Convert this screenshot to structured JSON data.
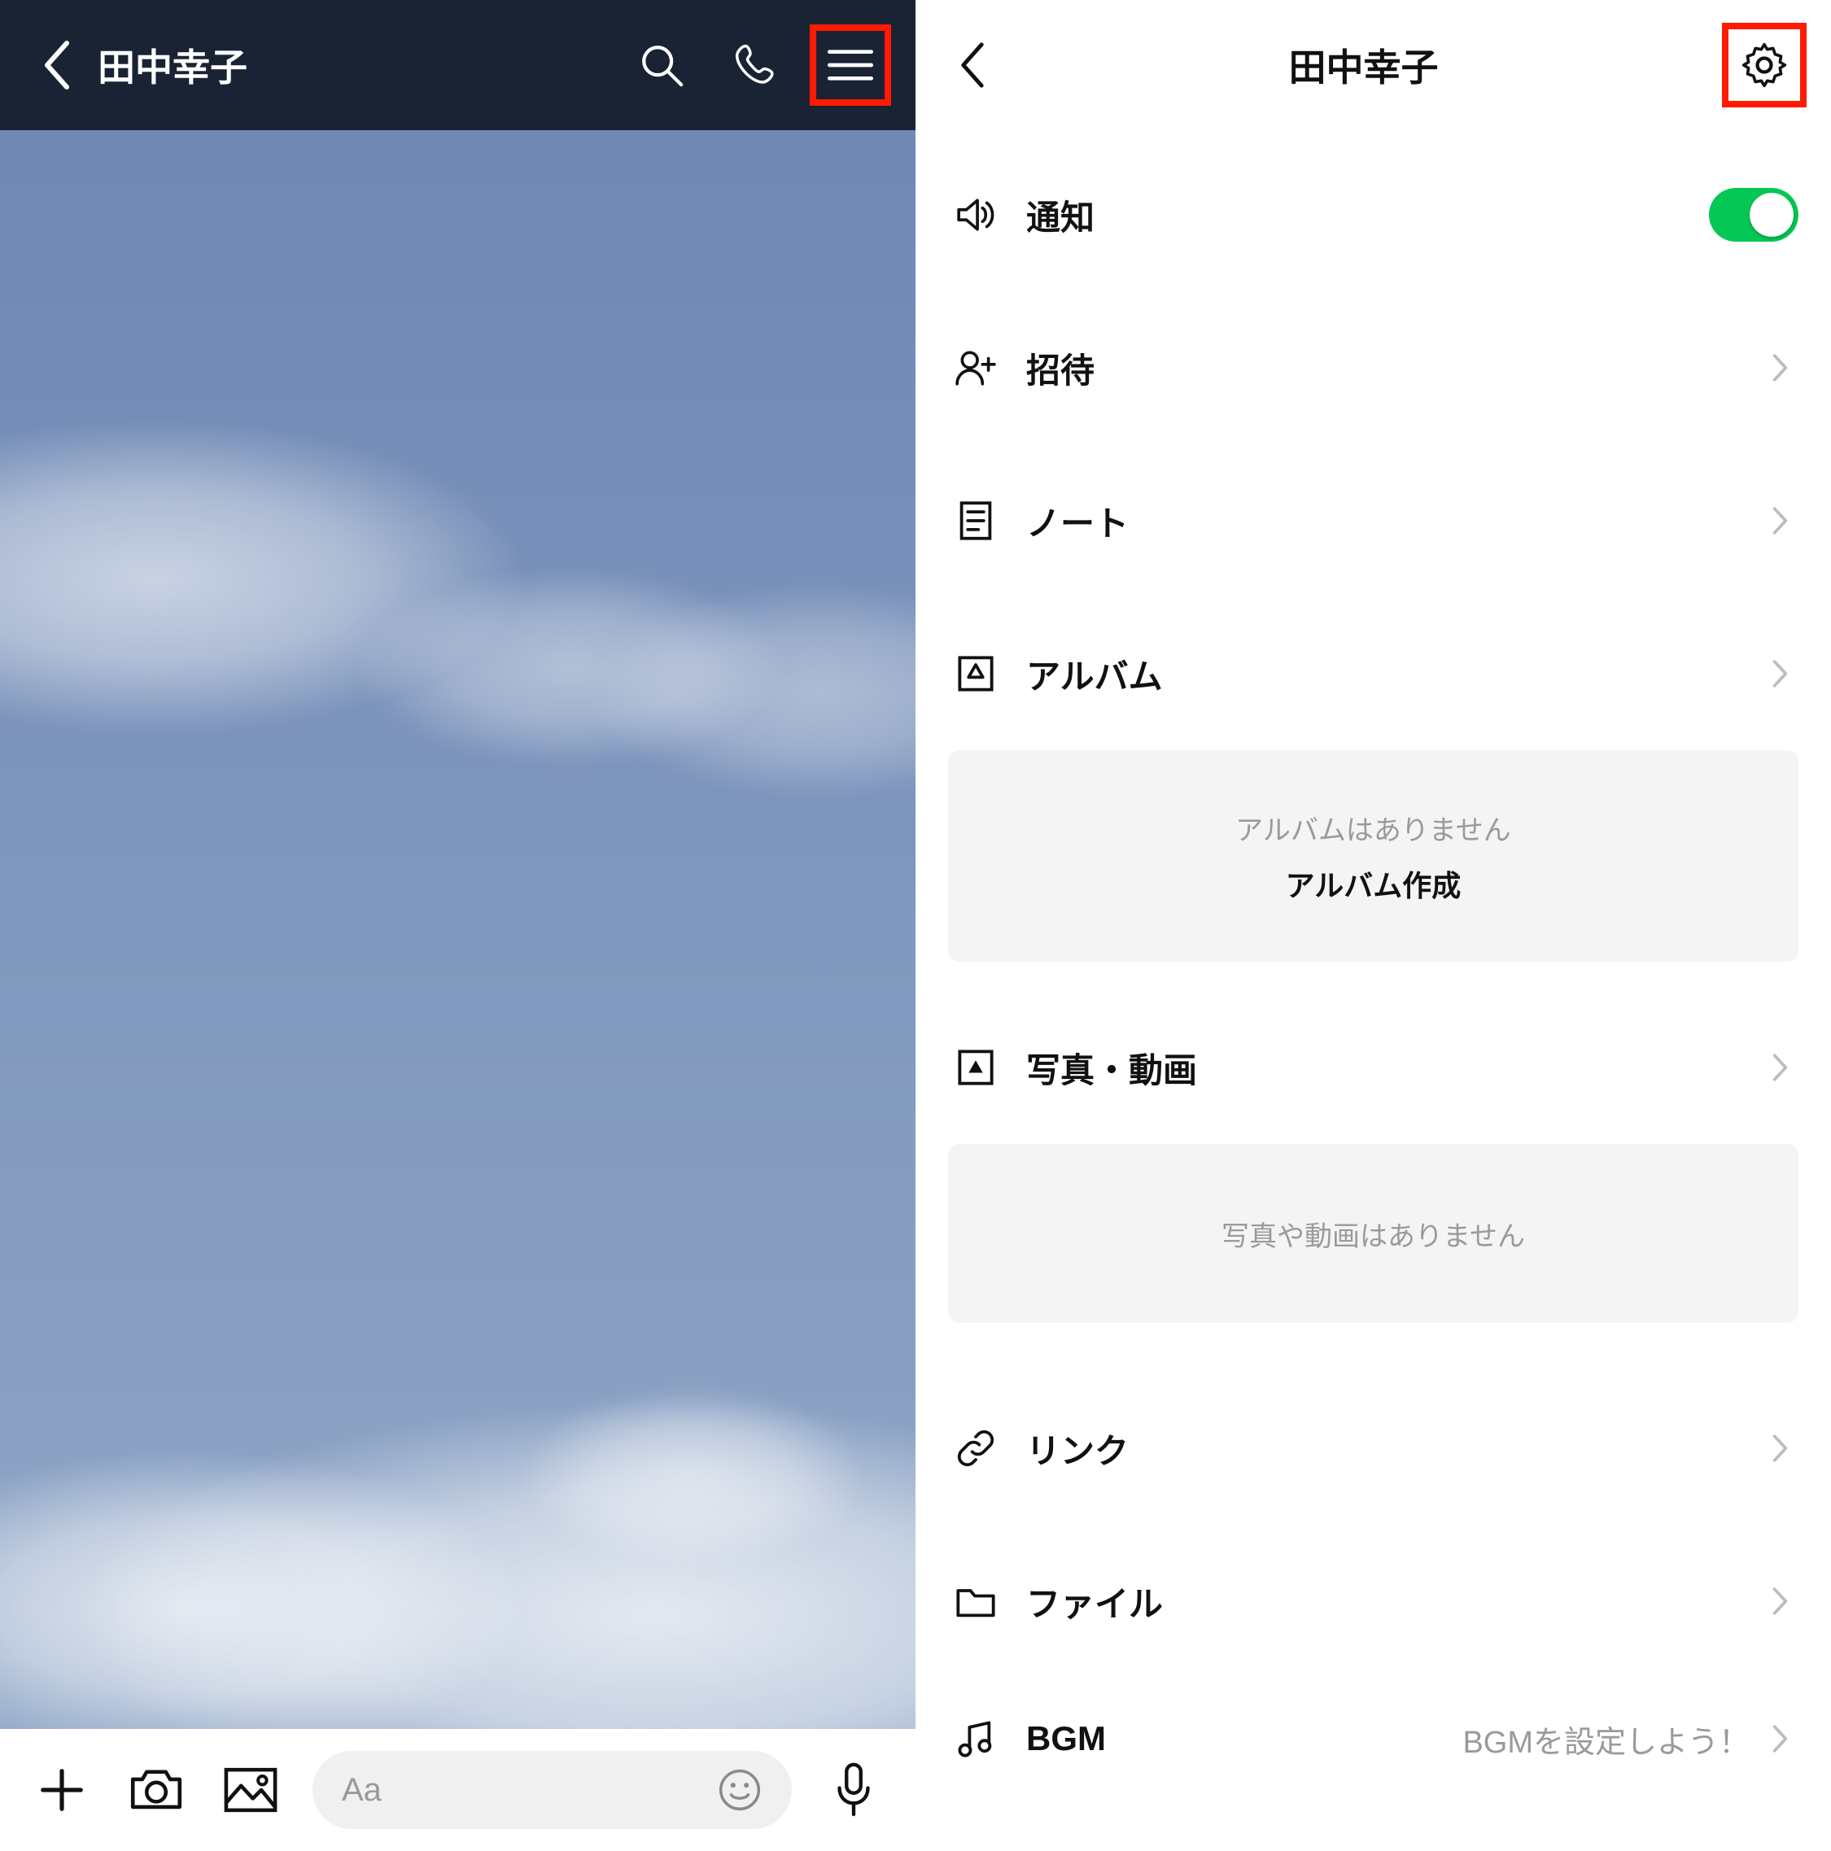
{
  "left": {
    "title": "田中幸子",
    "input_placeholder": "Aa"
  },
  "right": {
    "title": "田中幸子",
    "items": {
      "notify": "通知",
      "invite": "招待",
      "note": "ノート",
      "album": "アルバム",
      "photo": "写真・動画",
      "link": "リンク",
      "file": "ファイル",
      "bgm": "BGM"
    },
    "album_empty": "アルバムはありません",
    "album_create": "アルバム作成",
    "photo_empty": "写真や動画はありません",
    "bgm_hint": "BGMを設定しよう！"
  }
}
